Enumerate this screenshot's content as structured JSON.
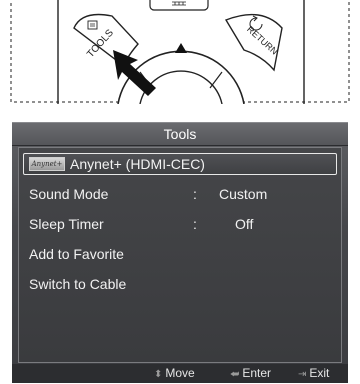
{
  "remote": {
    "tools_label": "TOOLS",
    "return_label": "RETURN"
  },
  "osd": {
    "title": "Tools",
    "items": [
      {
        "label": "Anynet+ (HDMI-CEC)",
        "logo_text": "Anynet+",
        "selected": true
      },
      {
        "label": "Sound Mode",
        "colon": ":",
        "value": "Custom"
      },
      {
        "label": "Sleep Timer",
        "colon": ":",
        "value": "Off"
      },
      {
        "label": "Add to Favorite"
      },
      {
        "label": "Switch to Cable"
      }
    ],
    "footer": {
      "move": {
        "icon": "up-down-arrow-icon",
        "label": "Move"
      },
      "enter": {
        "icon": "enter-icon",
        "label": "Enter"
      },
      "exit": {
        "icon": "exit-icon",
        "label": "Exit"
      }
    }
  },
  "colors": {
    "osd_background": "#46474b",
    "footer_background": "#2c2d30",
    "text": "#f2f2f2"
  }
}
